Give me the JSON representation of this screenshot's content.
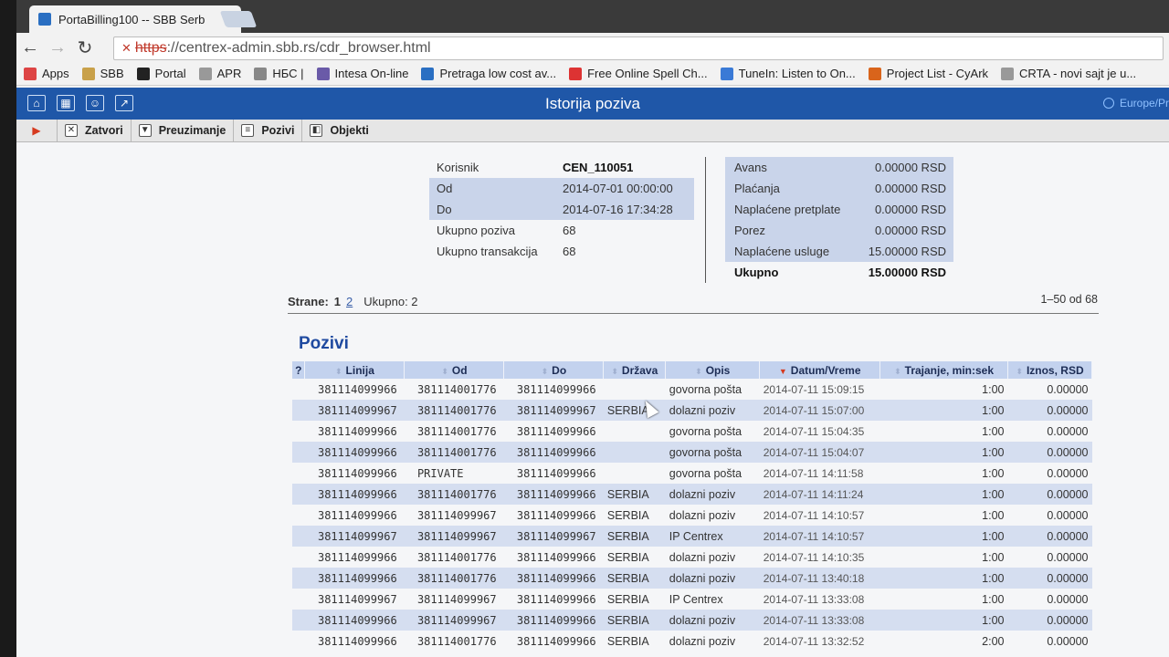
{
  "browser": {
    "tab_title": "PortaBilling100 -- SBB Serb",
    "tab_close": "×",
    "url_scheme": "https",
    "url_rest": "://centrex-admin.sbb.rs/cdr_browser.html",
    "nav": {
      "back": "←",
      "forward": "→",
      "reload": "↻"
    },
    "bookmarks": [
      {
        "label": "Apps",
        "icon": "apps-grid-icon",
        "color": "#d44"
      },
      {
        "label": "SBB",
        "icon": "folder-icon",
        "color": "#c9a14a"
      },
      {
        "label": "Portal",
        "icon": "sbb-logo-icon",
        "color": "#222"
      },
      {
        "label": "APR",
        "icon": "page-icon",
        "color": "#999"
      },
      {
        "label": "НБС |",
        "icon": "globe-icon",
        "color": "#888"
      },
      {
        "label": "Intesa On-line",
        "icon": "page-icon",
        "color": "#6a5aa8"
      },
      {
        "label": "Pretraga low cost av...",
        "icon": "circle-icon",
        "color": "#2a6fc2"
      },
      {
        "label": "Free Online Spell Ch...",
        "icon": "checkmark-icon",
        "color": "#d33"
      },
      {
        "label": "TuneIn: Listen to On...",
        "icon": "radio-icon",
        "color": "#3a7ad6"
      },
      {
        "label": "Project List - CyArk",
        "icon": "cyark-icon",
        "color": "#d9641b"
      },
      {
        "label": "CRTA - novi sajt je u...",
        "icon": "page-icon",
        "color": "#999"
      }
    ]
  },
  "app": {
    "title": "Istorija poziva",
    "timezone": "Europe/Pr",
    "actions": [
      {
        "label": "Zatvori",
        "icon": "close-icon",
        "glyph": "✕"
      },
      {
        "label": "Preuzimanje",
        "icon": "download-icon",
        "glyph": "▼"
      },
      {
        "label": "Pozivi",
        "icon": "calls-list-icon",
        "glyph": "≡"
      },
      {
        "label": "Objekti",
        "icon": "objects-icon",
        "glyph": "◧"
      }
    ],
    "header_icons": [
      {
        "name": "home-icon",
        "glyph": "⌂"
      },
      {
        "name": "grid-icon",
        "glyph": "▦"
      },
      {
        "name": "person-icon",
        "glyph": "☺"
      },
      {
        "name": "chart-icon",
        "glyph": "↗"
      }
    ]
  },
  "info": [
    {
      "k": "Korisnik",
      "v": "CEN_110051",
      "bold": true,
      "alt": false
    },
    {
      "k": "Od",
      "v": "2014-07-01 00:00:00",
      "bold": false,
      "alt": true
    },
    {
      "k": "Do",
      "v": "2014-07-16 17:34:28",
      "bold": false,
      "alt": true
    },
    {
      "k": "Ukupno poziva",
      "v": "68",
      "bold": false,
      "alt": false
    },
    {
      "k": "Ukupno transakcija",
      "v": "68",
      "bold": false,
      "alt": false
    }
  ],
  "finance": [
    {
      "k": "Avans",
      "v": "0.00000 RSD"
    },
    {
      "k": "Plaćanja",
      "v": "0.00000 RSD"
    },
    {
      "k": "Naplaćene pretplate",
      "v": "0.00000 RSD"
    },
    {
      "k": "Porez",
      "v": "0.00000 RSD"
    },
    {
      "k": "Naplaćene usluge",
      "v": "15.00000 RSD"
    },
    {
      "k": "Ukupno",
      "v": "15.00000 RSD",
      "total": true
    }
  ],
  "pager": {
    "label": "Strane:",
    "current": "1",
    "next": "2",
    "total": "Ukupno: 2",
    "range": "1–50 od 68"
  },
  "section_title": "Pozivi",
  "table": {
    "columns": [
      "?",
      "Linija",
      "Od",
      "Do",
      "Država",
      "Opis",
      "Datum/Vreme",
      "Trajanje, min:sek",
      "Iznos, RSD"
    ],
    "rows": [
      [
        "381114099966",
        "381114001776",
        "381114099966",
        "",
        "govorna pošta",
        "2014-07-11 15:09:15",
        "1:00",
        "0.00000"
      ],
      [
        "381114099967",
        "381114001776",
        "381114099967",
        "SERBIA",
        "dolazni poziv",
        "2014-07-11 15:07:00",
        "1:00",
        "0.00000"
      ],
      [
        "381114099966",
        "381114001776",
        "381114099966",
        "",
        "govorna pošta",
        "2014-07-11 15:04:35",
        "1:00",
        "0.00000"
      ],
      [
        "381114099966",
        "381114001776",
        "381114099966",
        "",
        "govorna pošta",
        "2014-07-11 15:04:07",
        "1:00",
        "0.00000"
      ],
      [
        "381114099966",
        "PRIVATE",
        "381114099966",
        "",
        "govorna pošta",
        "2014-07-11 14:11:58",
        "1:00",
        "0.00000"
      ],
      [
        "381114099966",
        "381114001776",
        "381114099966",
        "SERBIA",
        "dolazni poziv",
        "2014-07-11 14:11:24",
        "1:00",
        "0.00000"
      ],
      [
        "381114099966",
        "381114099967",
        "381114099966",
        "SERBIA",
        "dolazni poziv",
        "2014-07-11 14:10:57",
        "1:00",
        "0.00000"
      ],
      [
        "381114099967",
        "381114099967",
        "381114099967",
        "SERBIA",
        "IP Centrex",
        "2014-07-11 14:10:57",
        "1:00",
        "0.00000"
      ],
      [
        "381114099966",
        "381114001776",
        "381114099966",
        "SERBIA",
        "dolazni poziv",
        "2014-07-11 14:10:35",
        "1:00",
        "0.00000"
      ],
      [
        "381114099966",
        "381114001776",
        "381114099966",
        "SERBIA",
        "dolazni poziv",
        "2014-07-11 13:40:18",
        "1:00",
        "0.00000"
      ],
      [
        "381114099967",
        "381114099967",
        "381114099966",
        "SERBIA",
        "IP Centrex",
        "2014-07-11 13:33:08",
        "1:00",
        "0.00000"
      ],
      [
        "381114099966",
        "381114099967",
        "381114099966",
        "SERBIA",
        "dolazni poziv",
        "2014-07-11 13:33:08",
        "1:00",
        "0.00000"
      ],
      [
        "381114099966",
        "381114001776",
        "381114099966",
        "SERBIA",
        "dolazni poziv",
        "2014-07-11 13:32:52",
        "2:00",
        "0.00000"
      ]
    ]
  }
}
